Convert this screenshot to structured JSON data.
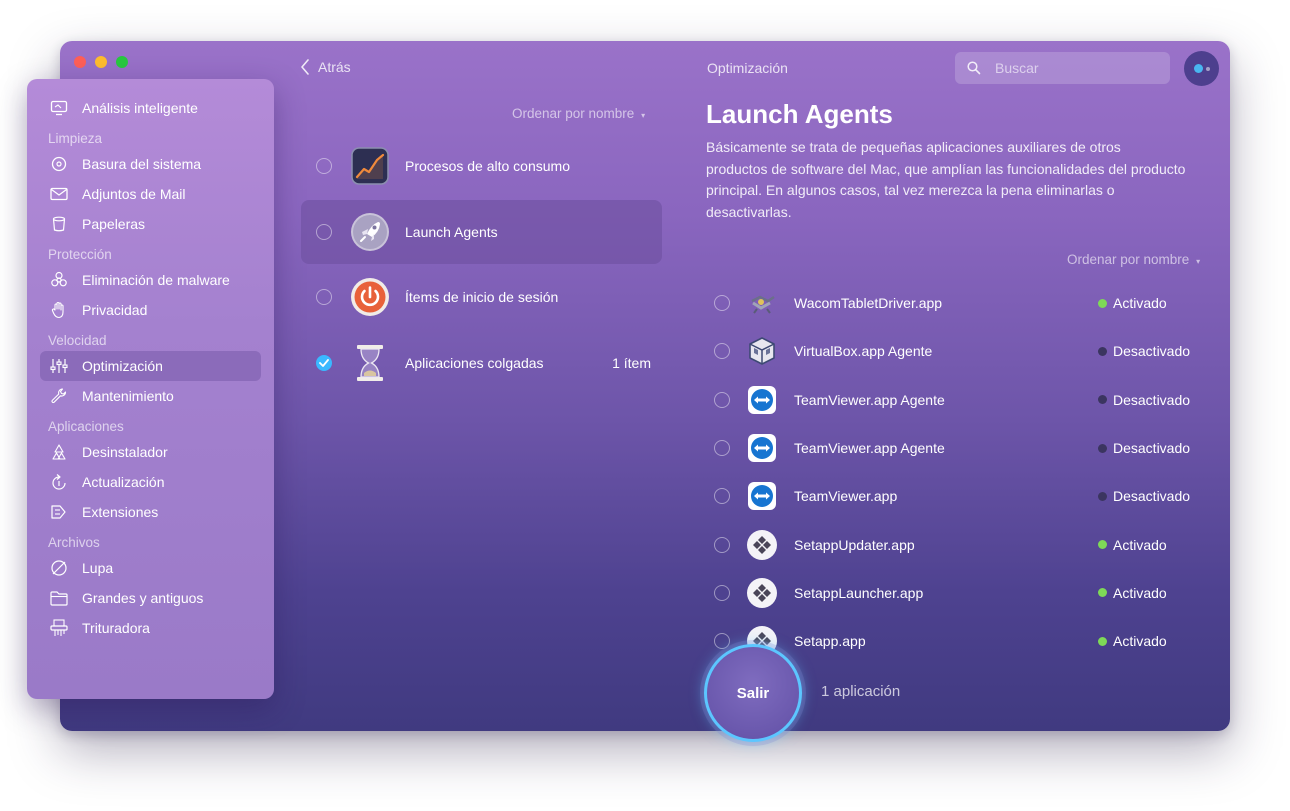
{
  "window": {
    "header_title": "Optimización",
    "back_label": "Atrás",
    "search_placeholder": "Buscar"
  },
  "sidebar": {
    "top_item": {
      "label": "Análisis inteligente",
      "icon": "monitor-icon"
    },
    "sections": [
      {
        "title": "Limpieza",
        "items": [
          {
            "label": "Basura del sistema",
            "icon": "disk-icon"
          },
          {
            "label": "Adjuntos de Mail",
            "icon": "mail-icon"
          },
          {
            "label": "Papeleras",
            "icon": "trash-icon"
          }
        ]
      },
      {
        "title": "Protección",
        "items": [
          {
            "label": "Eliminación de malware",
            "icon": "biohazard-icon"
          },
          {
            "label": "Privacidad",
            "icon": "hand-icon"
          }
        ]
      },
      {
        "title": "Velocidad",
        "items": [
          {
            "label": "Optimización",
            "icon": "sliders-icon"
          },
          {
            "label": "Mantenimiento",
            "icon": "wrench-icon"
          }
        ]
      },
      {
        "title": "Aplicaciones",
        "items": [
          {
            "label": "Desinstalador",
            "icon": "apps-icon"
          },
          {
            "label": "Actualización",
            "icon": "update-icon"
          },
          {
            "label": "Extensiones",
            "icon": "extension-icon"
          }
        ]
      },
      {
        "title": "Archivos",
        "items": [
          {
            "label": "Lupa",
            "icon": "lens-icon"
          },
          {
            "label": "Grandes y antiguos",
            "icon": "folder-icon"
          },
          {
            "label": "Trituradora",
            "icon": "shredder-icon"
          }
        ]
      }
    ],
    "active": "Optimización"
  },
  "middle": {
    "sort_label": "Ordenar por nombre",
    "items": [
      {
        "label": "Procesos de alto consumo",
        "icon": "activity-chart-icon",
        "checked": false,
        "count": ""
      },
      {
        "label": "Launch Agents",
        "icon": "rocket-icon",
        "checked": false,
        "count": ""
      },
      {
        "label": "Ítems de inicio de sesión",
        "icon": "power-icon",
        "checked": false,
        "count": ""
      },
      {
        "label": "Aplicaciones colgadas",
        "icon": "hourglass-icon",
        "checked": true,
        "count": "1 ítem"
      }
    ],
    "active": "Launch Agents"
  },
  "detail": {
    "title": "Launch Agents",
    "description": "Básicamente se trata de pequeñas aplicaciones auxiliares de otros productos de software del Mac, que amplían las funcionalidades del producto principal. En algunos casos, tal vez merezca la pena eliminarlas o desactivarlas.",
    "sort_label": "Ordenar por nombre",
    "items": [
      {
        "name": "WacomTabletDriver.app",
        "icon": "wacom-icon",
        "status": "Activado",
        "on": true
      },
      {
        "name": "VirtualBox.app Agente",
        "icon": "virtualbox-icon",
        "status": "Desactivado",
        "on": false
      },
      {
        "name": "TeamViewer.app Agente",
        "icon": "teamviewer-icon",
        "status": "Desactivado",
        "on": false
      },
      {
        "name": "TeamViewer.app Agente",
        "icon": "teamviewer-icon",
        "status": "Desactivado",
        "on": false
      },
      {
        "name": "TeamViewer.app",
        "icon": "teamviewer-icon",
        "status": "Desactivado",
        "on": false
      },
      {
        "name": "SetappUpdater.app",
        "icon": "setapp-icon",
        "status": "Activado",
        "on": true
      },
      {
        "name": "SetappLauncher.app",
        "icon": "setapp-icon",
        "status": "Activado",
        "on": true
      },
      {
        "name": "Setapp.app",
        "icon": "setapp-icon",
        "status": "Activado",
        "on": true
      }
    ]
  },
  "footer": {
    "action_label": "Salir",
    "count_label": "1 aplicación"
  },
  "colors": {
    "accent": "#3ab8ff",
    "status_on": "#7ed957",
    "status_off": "#3b3560"
  }
}
